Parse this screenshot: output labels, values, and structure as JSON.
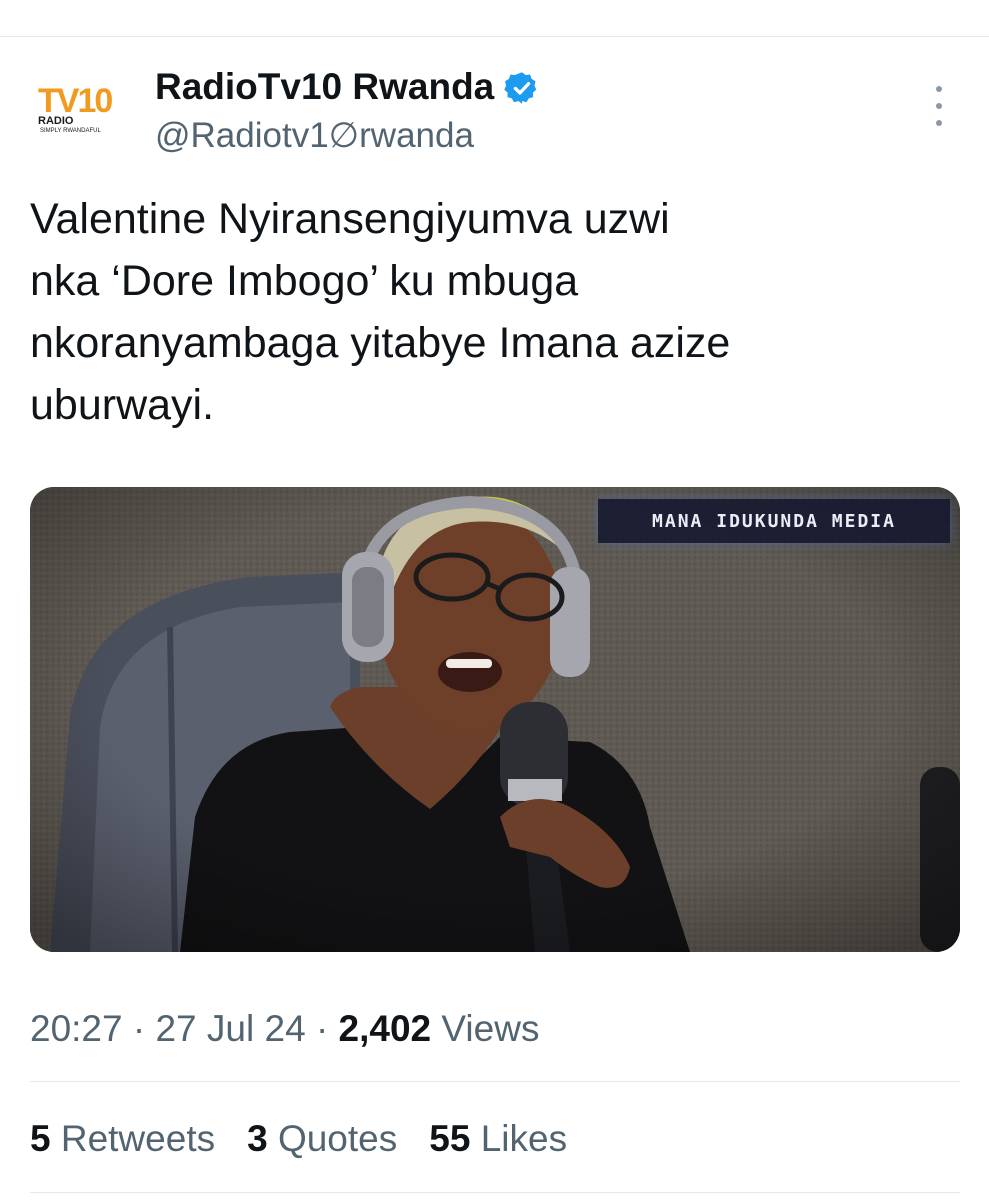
{
  "tweet": {
    "account": {
      "display_name": "RadioTv10 Rwanda",
      "handle": "@Radiotv1∅rwanda",
      "verified": true,
      "avatar": {
        "logo_text": "TV10",
        "logo_sub": "RADIO",
        "tagline": "SIMPLY RWANDAFUL"
      }
    },
    "more_icon": "more-vertical-icon",
    "text": "Valentine Nyiransengiyumva uzwi\nnka ‘Dore Imbogo’ ku mbuga\nnkoranyambaga yitabye Imana azize\nuburwayi.",
    "media": {
      "watermark": "MANA IDUKUNDA MEDIA"
    },
    "meta": {
      "time": "20:27",
      "separator": "·",
      "date": "27 Jul 24",
      "views_count": "2,402",
      "views_label": "Views"
    },
    "stats": {
      "retweets_count": "5",
      "retweets_label": "Retweets",
      "quotes_count": "3",
      "quotes_label": "Quotes",
      "likes_count": "55",
      "likes_label": "Likes"
    }
  },
  "colors": {
    "text_primary": "#0f1419",
    "text_secondary": "#536471",
    "verified_blue": "#1d9bf0",
    "divider": "#e6e9ec",
    "logo_orange": "#f29a1f"
  }
}
